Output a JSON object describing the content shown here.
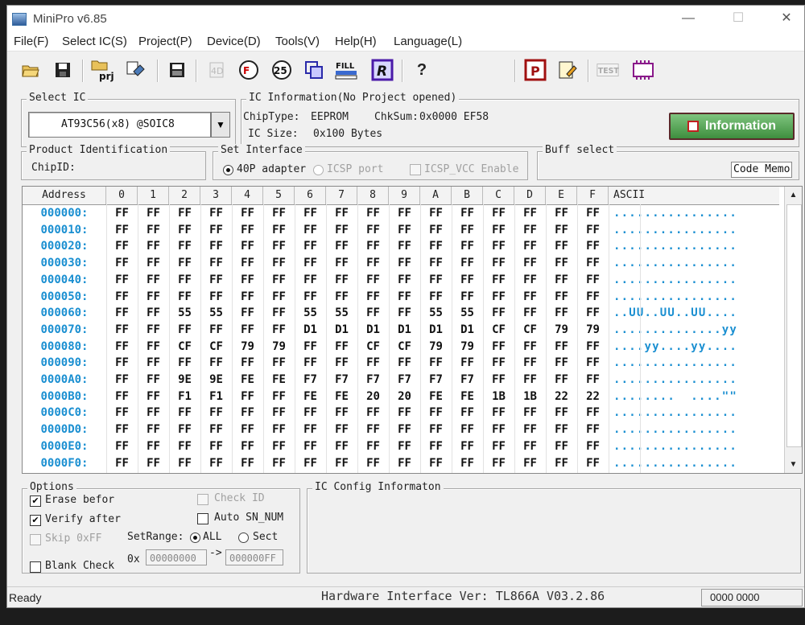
{
  "window": {
    "title": "MiniPro v6.85",
    "minimize": "—",
    "maximize": "☐",
    "close": "✕"
  },
  "menu": [
    "File(F)",
    "Select IC(S)",
    "Project(P)",
    "Device(D)",
    "Tools(V)",
    "Help(H)",
    "Language(L)"
  ],
  "toolbar": {
    "icons": [
      "open-icon",
      "save-icon",
      "save-project-icon",
      "load-icon",
      "save-chip-icon",
      "read-icon",
      "verify-icon",
      "blank-check-icon",
      "program-icon",
      "fill-icon",
      "read-id-icon",
      "help-icon",
      "config-icon",
      "edit-icon",
      "test-icon",
      "chip-icon"
    ],
    "prj_label": "prj",
    "fill_label": "FILL",
    "r_label": "R",
    "test_label": "TEST",
    "p_label": "P",
    "i4d_label": "4D",
    "i25_label": "25"
  },
  "select_ic": {
    "group": "Select IC",
    "value": "AT93C56(x8) @SOIC8"
  },
  "ic_info": {
    "group": "IC Information(No Project opened)",
    "chip_type_label": "ChipType:",
    "chip_type": "EEPROM",
    "chksum_label": "ChkSum:",
    "chksum": "0x0000 EF58",
    "ic_size_label": "IC Size:",
    "ic_size": "0x100 Bytes",
    "info_button": "Information"
  },
  "product": {
    "group": "Product Identification",
    "chip_id_label": "ChipID:"
  },
  "interface": {
    "group": "Set Interface",
    "opt1": "40P adapter",
    "opt2": "ICSP port",
    "opt3": "ICSP_VCC Enable"
  },
  "buff": {
    "group": "Buff select",
    "code_memo": "Code Memo"
  },
  "grid": {
    "headers": [
      "Address",
      "0",
      "1",
      "2",
      "3",
      "4",
      "5",
      "6",
      "7",
      "8",
      "9",
      "A",
      "B",
      "C",
      "D",
      "E",
      "F",
      "ASCII"
    ],
    "rows": [
      {
        "addr": "000000:",
        "bytes": [
          "FF",
          "FF",
          "FF",
          "FF",
          "FF",
          "FF",
          "FF",
          "FF",
          "FF",
          "FF",
          "FF",
          "FF",
          "FF",
          "FF",
          "FF",
          "FF"
        ],
        "ascii": "................"
      },
      {
        "addr": "000010:",
        "bytes": [
          "FF",
          "FF",
          "FF",
          "FF",
          "FF",
          "FF",
          "FF",
          "FF",
          "FF",
          "FF",
          "FF",
          "FF",
          "FF",
          "FF",
          "FF",
          "FF"
        ],
        "ascii": "................"
      },
      {
        "addr": "000020:",
        "bytes": [
          "FF",
          "FF",
          "FF",
          "FF",
          "FF",
          "FF",
          "FF",
          "FF",
          "FF",
          "FF",
          "FF",
          "FF",
          "FF",
          "FF",
          "FF",
          "FF"
        ],
        "ascii": "................"
      },
      {
        "addr": "000030:",
        "bytes": [
          "FF",
          "FF",
          "FF",
          "FF",
          "FF",
          "FF",
          "FF",
          "FF",
          "FF",
          "FF",
          "FF",
          "FF",
          "FF",
          "FF",
          "FF",
          "FF"
        ],
        "ascii": "................"
      },
      {
        "addr": "000040:",
        "bytes": [
          "FF",
          "FF",
          "FF",
          "FF",
          "FF",
          "FF",
          "FF",
          "FF",
          "FF",
          "FF",
          "FF",
          "FF",
          "FF",
          "FF",
          "FF",
          "FF"
        ],
        "ascii": "................"
      },
      {
        "addr": "000050:",
        "bytes": [
          "FF",
          "FF",
          "FF",
          "FF",
          "FF",
          "FF",
          "FF",
          "FF",
          "FF",
          "FF",
          "FF",
          "FF",
          "FF",
          "FF",
          "FF",
          "FF"
        ],
        "ascii": "................"
      },
      {
        "addr": "000060:",
        "bytes": [
          "FF",
          "FF",
          "55",
          "55",
          "FF",
          "FF",
          "55",
          "55",
          "FF",
          "FF",
          "55",
          "55",
          "FF",
          "FF",
          "FF",
          "FF"
        ],
        "ascii": "..UU..UU..UU...."
      },
      {
        "addr": "000070:",
        "bytes": [
          "FF",
          "FF",
          "FF",
          "FF",
          "FF",
          "FF",
          "D1",
          "D1",
          "D1",
          "D1",
          "D1",
          "D1",
          "CF",
          "CF",
          "79",
          "79"
        ],
        "ascii": "..............yy"
      },
      {
        "addr": "000080:",
        "bytes": [
          "FF",
          "FF",
          "CF",
          "CF",
          "79",
          "79",
          "FF",
          "FF",
          "CF",
          "CF",
          "79",
          "79",
          "FF",
          "FF",
          "FF",
          "FF"
        ],
        "ascii": "....yy....yy...."
      },
      {
        "addr": "000090:",
        "bytes": [
          "FF",
          "FF",
          "FF",
          "FF",
          "FF",
          "FF",
          "FF",
          "FF",
          "FF",
          "FF",
          "FF",
          "FF",
          "FF",
          "FF",
          "FF",
          "FF"
        ],
        "ascii": "................"
      },
      {
        "addr": "0000A0:",
        "bytes": [
          "FF",
          "FF",
          "9E",
          "9E",
          "FE",
          "FE",
          "F7",
          "F7",
          "F7",
          "F7",
          "F7",
          "F7",
          "FF",
          "FF",
          "FF",
          "FF"
        ],
        "ascii": "................"
      },
      {
        "addr": "0000B0:",
        "bytes": [
          "FF",
          "FF",
          "F1",
          "F1",
          "FF",
          "FF",
          "FE",
          "FE",
          "20",
          "20",
          "FE",
          "FE",
          "1B",
          "1B",
          "22",
          "22"
        ],
        "ascii": "........  ....\"\""
      },
      {
        "addr": "0000C0:",
        "bytes": [
          "FF",
          "FF",
          "FF",
          "FF",
          "FF",
          "FF",
          "FF",
          "FF",
          "FF",
          "FF",
          "FF",
          "FF",
          "FF",
          "FF",
          "FF",
          "FF"
        ],
        "ascii": "................"
      },
      {
        "addr": "0000D0:",
        "bytes": [
          "FF",
          "FF",
          "FF",
          "FF",
          "FF",
          "FF",
          "FF",
          "FF",
          "FF",
          "FF",
          "FF",
          "FF",
          "FF",
          "FF",
          "FF",
          "FF"
        ],
        "ascii": "................"
      },
      {
        "addr": "0000E0:",
        "bytes": [
          "FF",
          "FF",
          "FF",
          "FF",
          "FF",
          "FF",
          "FF",
          "FF",
          "FF",
          "FF",
          "FF",
          "FF",
          "FF",
          "FF",
          "FF",
          "FF"
        ],
        "ascii": "................"
      },
      {
        "addr": "0000F0:",
        "bytes": [
          "FF",
          "FF",
          "FF",
          "FF",
          "FF",
          "FF",
          "FF",
          "FF",
          "FF",
          "FF",
          "FF",
          "FF",
          "FF",
          "FF",
          "FF",
          "FF"
        ],
        "ascii": "................"
      }
    ]
  },
  "options": {
    "group": "Options",
    "erase": "Erase befor",
    "verify": "Verify after",
    "skip": "Skip 0xFF",
    "blank": "Blank Check",
    "check_id": "Check ID",
    "auto_sn": "Auto SN_NUM",
    "set_range": "SetRange:",
    "all": "ALL",
    "sect": "Sect",
    "hex_prefix": "0x",
    "range_from": "00000000",
    "arrow": "->",
    "range_to": "000000FF"
  },
  "config": {
    "group": "IC Config Informaton"
  },
  "status": {
    "ready": "Ready",
    "hw": "Hardware Interface Ver: TL866A V03.2.86",
    "code": "0000 0000"
  }
}
